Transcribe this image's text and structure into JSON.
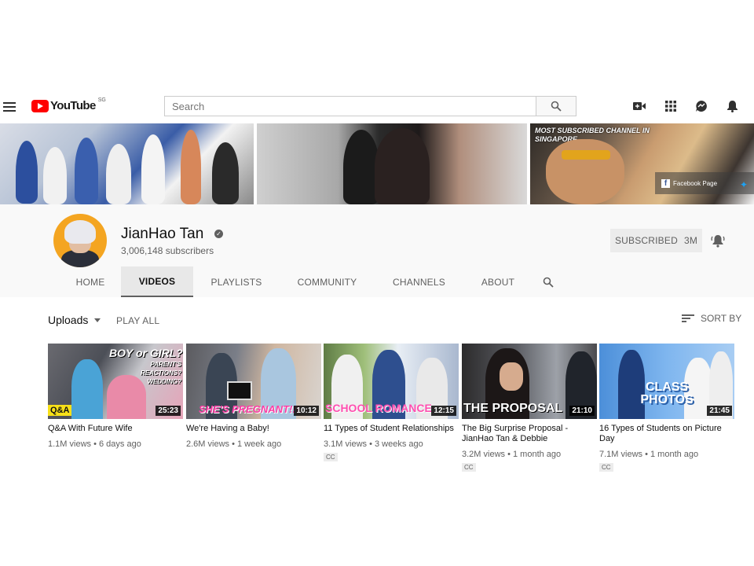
{
  "header": {
    "logo_text": "YouTube",
    "region": "SG",
    "search_placeholder": "Search"
  },
  "banner": {
    "star_text": "MOST SUBSCRIBED CHANNEL IN SINGAPORE",
    "facebook_label": "Facebook Page"
  },
  "channel": {
    "name": "JianHao Tan",
    "subscribers": "3,006,148 subscribers",
    "subscribe_label": "SUBSCRIBED",
    "subscribe_count": "3M"
  },
  "tabs": [
    {
      "label": "HOME"
    },
    {
      "label": "VIDEOS"
    },
    {
      "label": "PLAYLISTS"
    },
    {
      "label": "COMMUNITY"
    },
    {
      "label": "CHANNELS"
    },
    {
      "label": "ABOUT"
    }
  ],
  "toolbar": {
    "uploads_label": "Uploads",
    "play_all_label": "PLAY ALL",
    "sort_label": "SORT BY"
  },
  "videos": [
    {
      "title": "Q&A With Future Wife",
      "views": "1.1M views",
      "age": "6 days ago",
      "duration": "25:23",
      "thumb_text": "BOY or GIRL?",
      "thumb_sub": "PARENT'S REACTIONS? WEDDING?",
      "thumb_tag": "Q&A",
      "cc": ""
    },
    {
      "title": "We're Having a Baby!",
      "views": "2.6M views",
      "age": "1 week ago",
      "duration": "10:12",
      "thumb_text": "SHE'S PREGNANT!!!",
      "cc": ""
    },
    {
      "title": "11 Types of Student Relationships",
      "views": "3.1M views",
      "age": "3 weeks ago",
      "duration": "12:15",
      "thumb_text": "SCHOOL ROMANCE",
      "cc": "CC"
    },
    {
      "title": "The Big Surprise Proposal - JianHao Tan & Debbie",
      "views": "3.2M views",
      "age": "1 month ago",
      "duration": "21:10",
      "thumb_text": "THE PROPOSAL",
      "cc": "CC"
    },
    {
      "title": "16 Types of Students on Picture Day",
      "views": "7.1M views",
      "age": "1 month ago",
      "duration": "21:45",
      "thumb_text": "CLASS PHOTOS",
      "cc": "CC"
    }
  ]
}
